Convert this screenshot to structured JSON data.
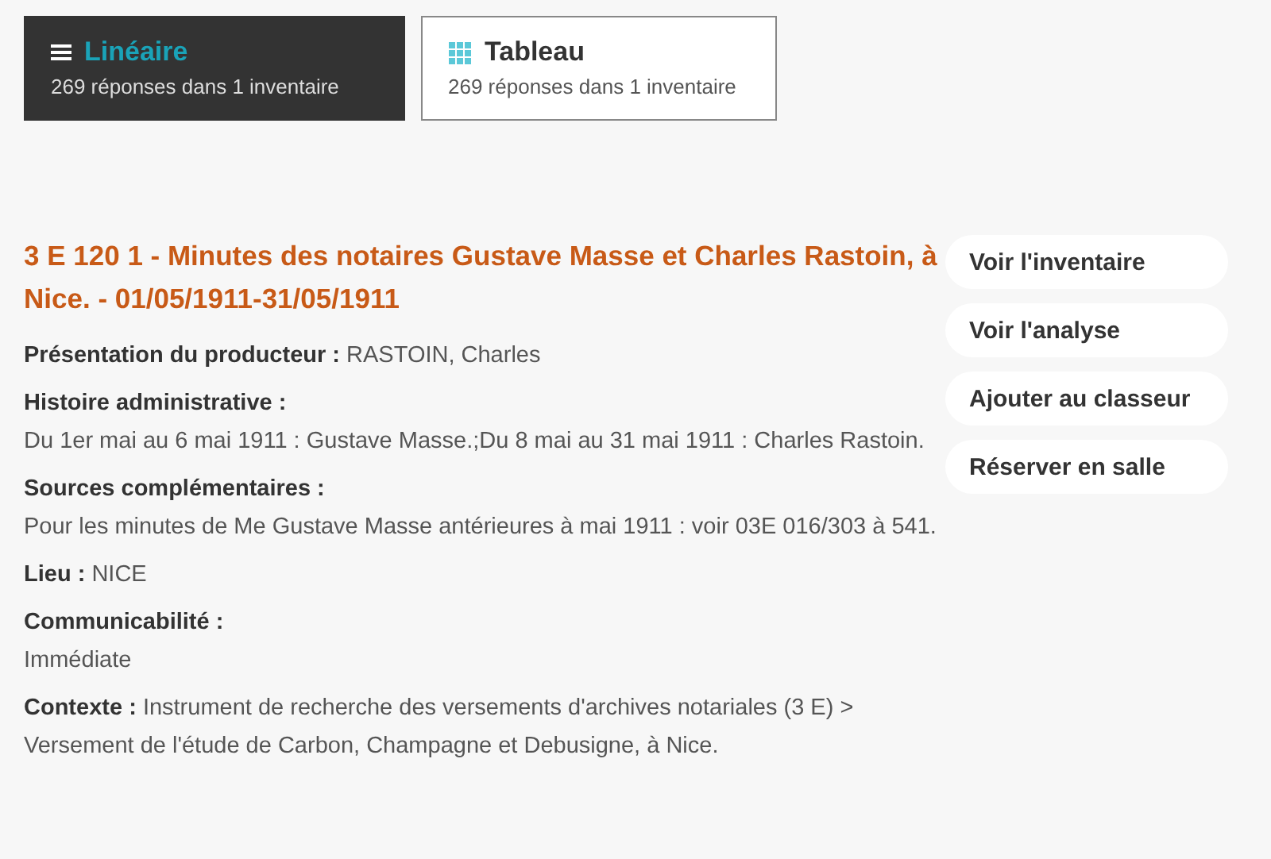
{
  "view_tabs": [
    {
      "kind": "list",
      "label": "Linéaire",
      "count": "269 réponses dans 1 inventaire",
      "selected": true
    },
    {
      "kind": "grid",
      "label": "Tableau",
      "count": "269 réponses dans 1 inventaire",
      "selected": false
    }
  ],
  "record": {
    "title": "3 E 120 1 - Minutes des notaires Gustave Masse et Charles Rastoin, à Nice. - 01/05/1911-31/05/1911",
    "fields": [
      {
        "kind": "inline",
        "label": "Présentation du producteur :",
        "value": "RASTOIN, Charles"
      },
      {
        "kind": "block",
        "label": "Histoire administrative :",
        "value": "Du 1er mai au 6 mai 1911 : Gustave Masse.;Du 8 mai au 31 mai 1911 : Charles Rastoin."
      },
      {
        "kind": "block",
        "label": "Sources complémentaires :",
        "value": "Pour les minutes de Me Gustave Masse antérieures à mai 1911 : voir 03E 016/303 à 541."
      },
      {
        "kind": "inline",
        "label": "Lieu :",
        "value": "NICE"
      },
      {
        "kind": "block",
        "label": "Communicabilité :",
        "value": "Immédiate"
      },
      {
        "kind": "inline",
        "label": "Contexte :",
        "value": "Instrument de recherche des versements d'archives notariales (3 E) > Versement de l'étude de Carbon, Champagne et Debusigne, à Nice."
      }
    ],
    "actions": [
      "Voir l'inventaire",
      "Voir l'analyse",
      "Ajouter au classeur",
      "Réserver en salle"
    ]
  }
}
